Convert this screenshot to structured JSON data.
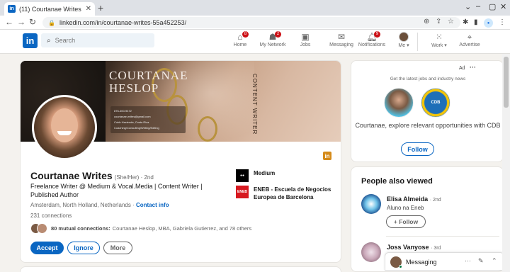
{
  "browser": {
    "tab_title": "(11) Courtanae Writes | LinkedIn",
    "url": "linkedin.com/in/courtanae-writes-55a452253/"
  },
  "nav": {
    "search_placeholder": "Search",
    "items": [
      {
        "label": "Home",
        "badge": "8"
      },
      {
        "label": "My Network",
        "badge": "2"
      },
      {
        "label": "Jobs",
        "badge": ""
      },
      {
        "label": "Messaging",
        "badge": ""
      },
      {
        "label": "Notifications",
        "badge": "9"
      },
      {
        "label": "Me ▾",
        "badge": ""
      },
      {
        "label": "Work ▾",
        "badge": ""
      },
      {
        "label": "Advertise",
        "badge": ""
      }
    ]
  },
  "banner": {
    "name_line1": "COURTANAE",
    "name_line2": "HESLOP",
    "vertical_text": "CONTENT WRITER",
    "info": [
      "876-400-9472",
      "courtanae.writes@gmail.com",
      "Cobb Hacienda, Costa Rica",
      "Coaching/Consulting/Writing/Editing"
    ]
  },
  "profile": {
    "name": "Courtanae Writes",
    "pronouns": "(She/Her) · 2nd",
    "headline": "Freelance Writer @ Medium & Vocal.Media | Content Writer | Published Author",
    "location": "Amsterdam, North Holland, Netherlands · ",
    "contact_info": "Contact info",
    "connections": "231 connections",
    "mutual_count": "80 mutual connections:",
    "mutual_names": "Courtanae Heslop, MBA, Gabriela Gutierrez, and 78 others",
    "buttons": {
      "accept": "Accept",
      "ignore": "Ignore",
      "more": "More"
    },
    "orgs": [
      {
        "name": "Medium",
        "logo": "medium-logo"
      },
      {
        "name": "ENEB - Escuela de Negocios Europea de Barcelona",
        "logo": "eneb-logo"
      }
    ]
  },
  "ad": {
    "label": "Ad",
    "tagline": "Get the latest jobs and industry news",
    "message": "Courtanae, explore relevant opportunities with CDB",
    "follow": "Follow",
    "org_abbr": "CDB"
  },
  "people_also_viewed": {
    "title": "People also viewed",
    "people": [
      {
        "name": "Elisa Almeida",
        "degree": "· 2nd",
        "subtitle": "Aluno na Eneb",
        "follow": "+ Follow"
      },
      {
        "name": "Joss Vanyose",
        "degree": "· 3rd",
        "subtitle": "",
        "follow": ""
      }
    ]
  },
  "messaging": {
    "label": "Messaging"
  },
  "colors": {
    "brand": "#0a66c2",
    "badge": "#cc1016",
    "accent_orange": "#d58b1a"
  }
}
